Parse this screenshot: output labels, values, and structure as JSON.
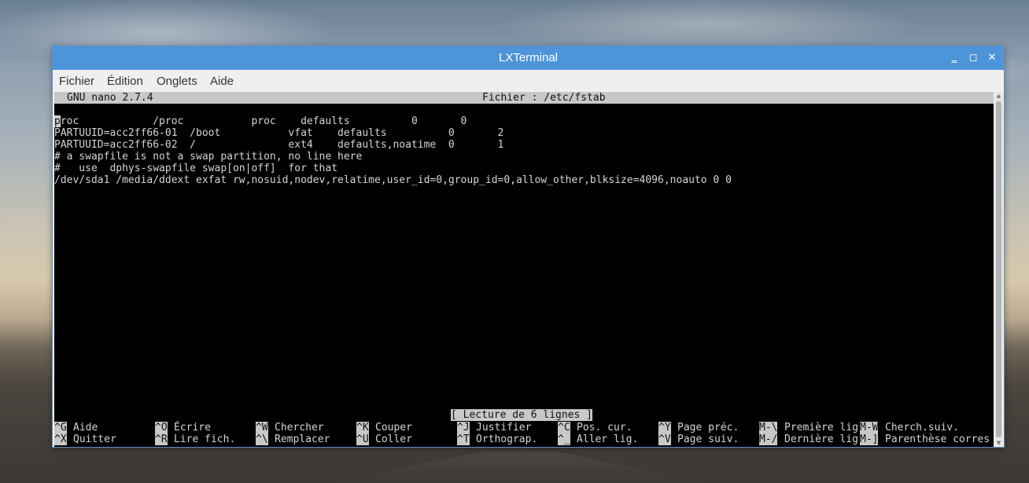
{
  "window": {
    "title": "LXTerminal",
    "minimize_glyph": "‗",
    "maximize_glyph": "◻",
    "close_glyph": "✕"
  },
  "menu": [
    "Fichier",
    "Édition",
    "Onglets",
    "Aide"
  ],
  "nano": {
    "version": "GNU nano 2.7.4",
    "file": "Fichier : /etc/fstab",
    "cursor_char": "p",
    "lines": [
      "roc            /proc           proc    defaults          0       0",
      "PARTUUID=acc2ff66-01  /boot           vfat    defaults          0       2",
      "PARTUUID=acc2ff66-02  /               ext4    defaults,noatime  0       1",
      "# a swapfile is not a swap partition, no line here",
      "#   use  dphys-swapfile swap[on|off]  for that",
      "/dev/sda1 /media/ddext exfat rw,nosuid,nodev,relatime,user_id=0,group_id=0,allow_other,blksize=4096,noauto 0 0"
    ],
    "status": "[ Lecture de 6 lignes ]",
    "shortcuts_row1": [
      {
        "key": "^G",
        "label": "Aide"
      },
      {
        "key": "^O",
        "label": "Écrire"
      },
      {
        "key": "^W",
        "label": "Chercher"
      },
      {
        "key": "^K",
        "label": "Couper"
      },
      {
        "key": "^J",
        "label": "Justifier"
      },
      {
        "key": "^C",
        "label": "Pos. cur."
      },
      {
        "key": "^Y",
        "label": "Page préc."
      },
      {
        "key": "M-\\",
        "label": "Première lig"
      },
      {
        "key": "M-W",
        "label": "Cherch.suiv."
      }
    ],
    "shortcuts_row2": [
      {
        "key": "^X",
        "label": "Quitter"
      },
      {
        "key": "^R",
        "label": "Lire fich."
      },
      {
        "key": "^\\",
        "label": "Remplacer"
      },
      {
        "key": "^U",
        "label": "Coller"
      },
      {
        "key": "^T",
        "label": "Orthograp."
      },
      {
        "key": "^_",
        "label": "Aller lig."
      },
      {
        "key": "^V",
        "label": "Page suiv."
      },
      {
        "key": "M-/",
        "label": "Dernière lig"
      },
      {
        "key": "M-]",
        "label": "Parenthèse corres"
      }
    ]
  },
  "colors": {
    "titlebar": "#4d95d8",
    "terminal_bg": "#000000",
    "terminal_fg": "#d4d4d4",
    "nano_bar": "#c8c8c8"
  }
}
